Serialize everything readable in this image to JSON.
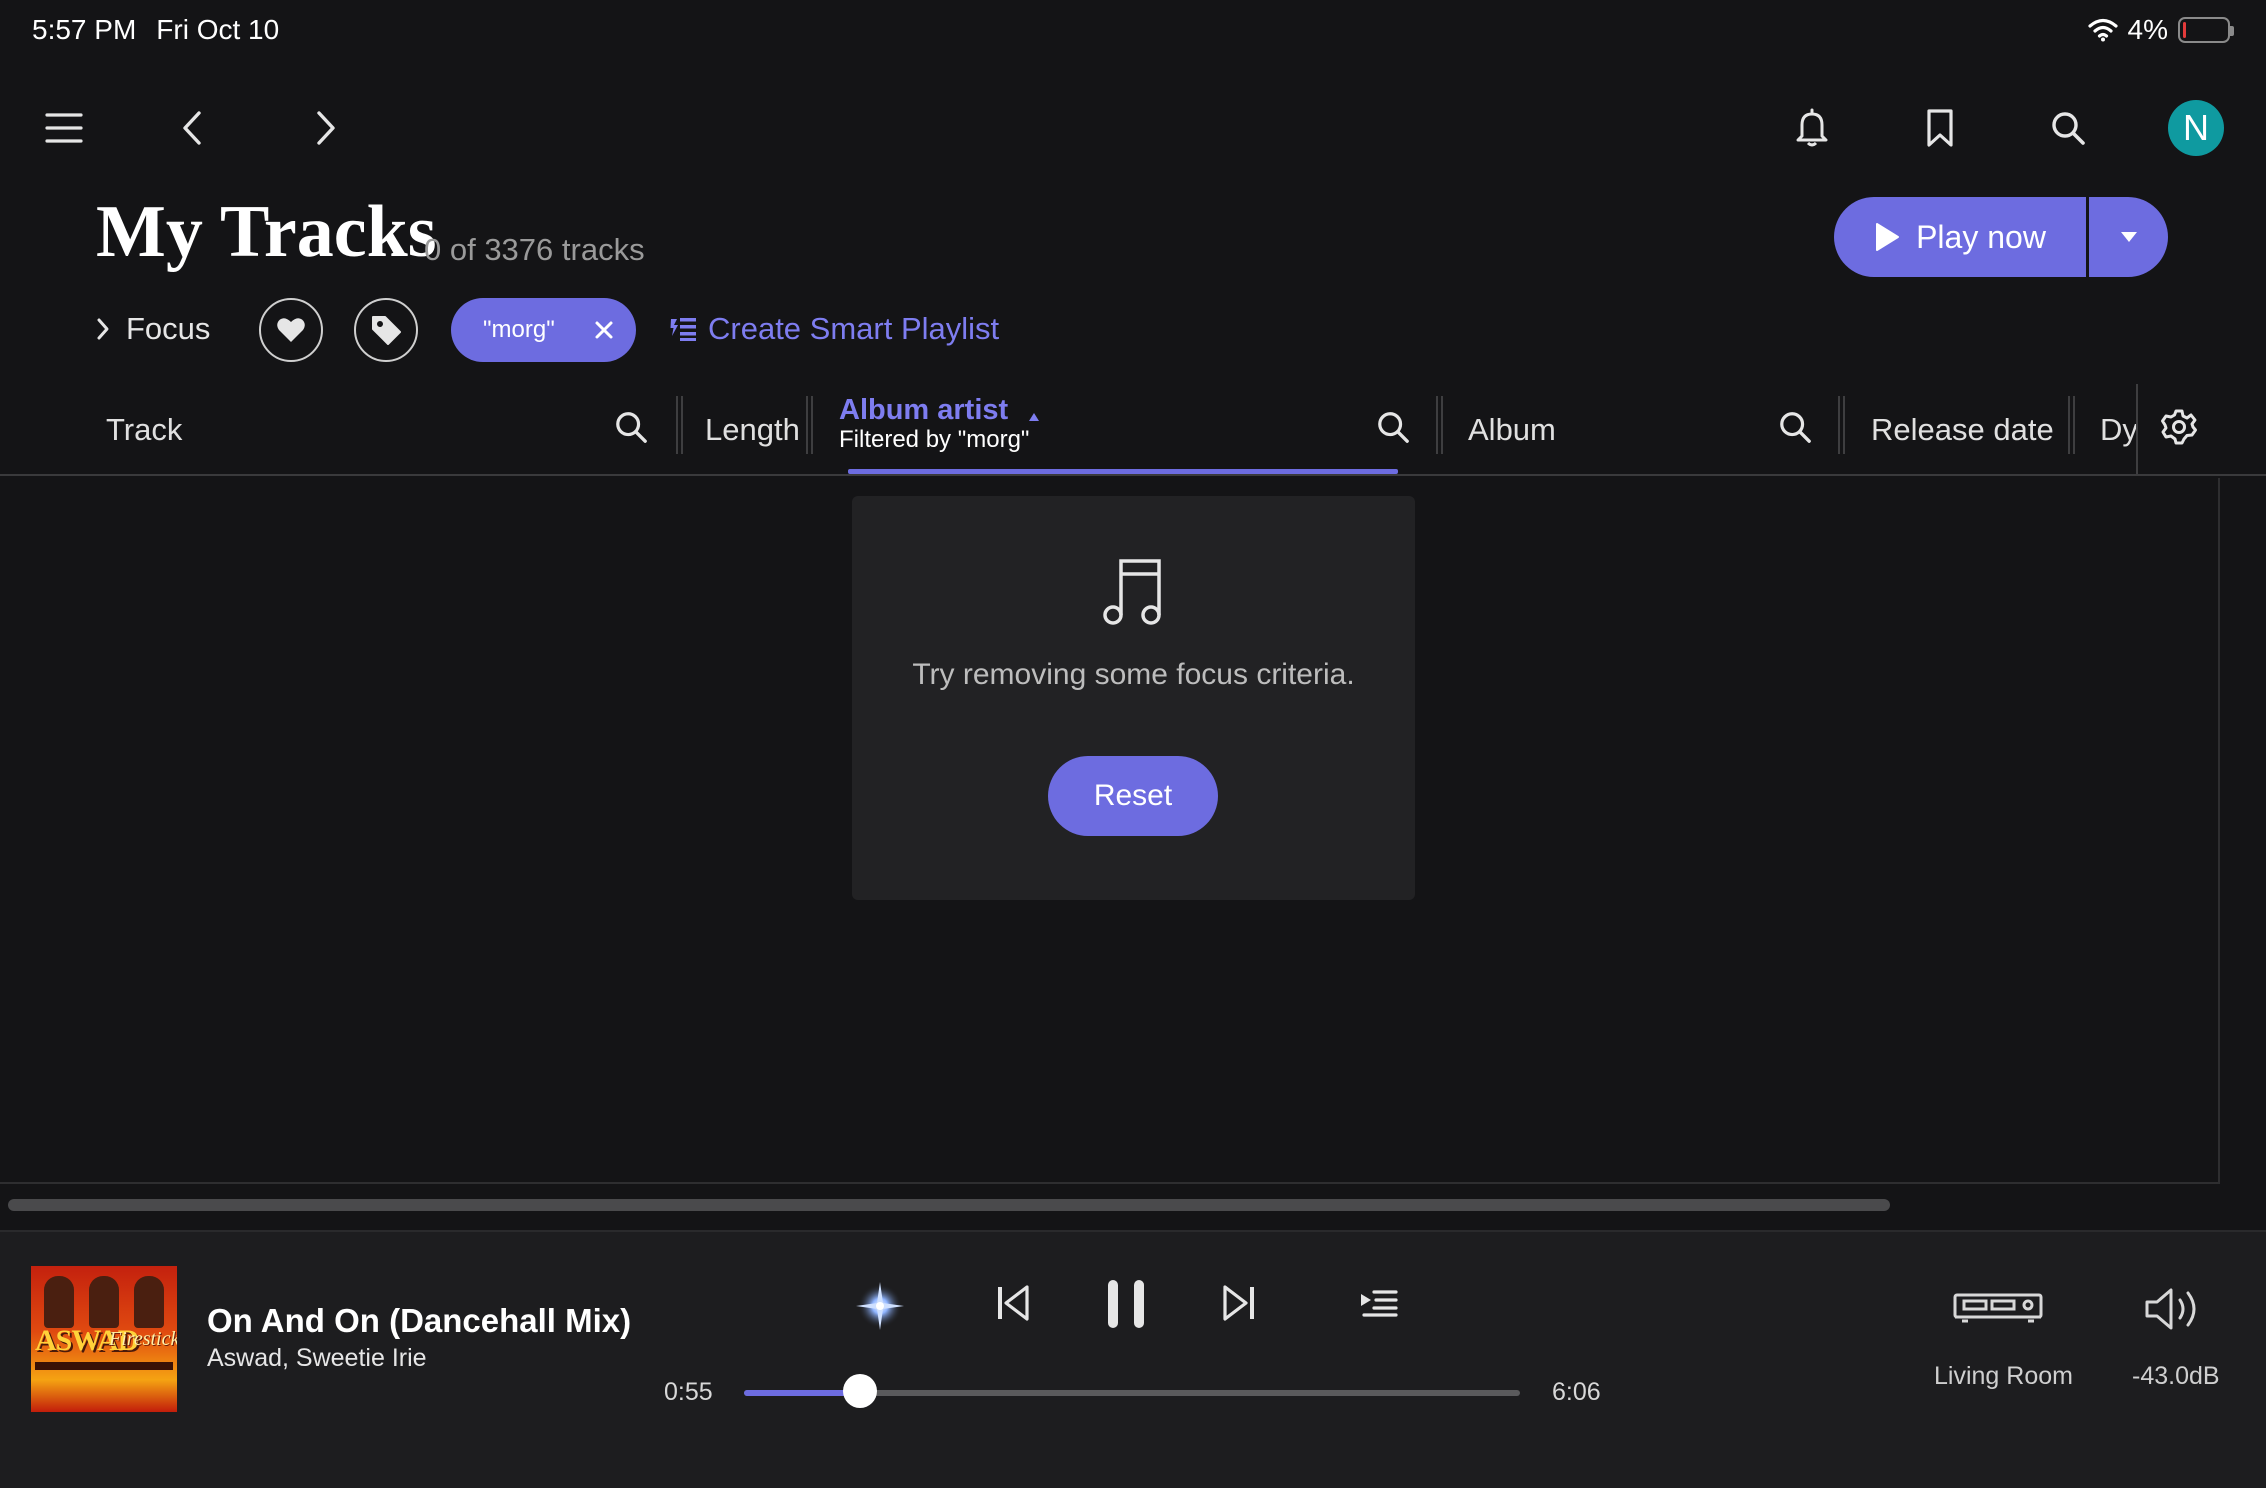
{
  "status_bar": {
    "time": "5:57 PM",
    "date": "Fri Oct 10",
    "battery_percent": "4%",
    "battery_level": 0.04
  },
  "nav": {
    "menu_icon": "hamburger-icon",
    "back_icon": "chevron-left-icon",
    "forward_icon": "chevron-right-icon",
    "notifications_icon": "bell-icon",
    "bookmarks_icon": "bookmark-icon",
    "search_icon": "search-icon",
    "avatar_initial": "N",
    "avatar_color": "#0f9aa0"
  },
  "header": {
    "title": "My Tracks",
    "track_count": "0 of 3376 tracks",
    "play_now_label": "Play now"
  },
  "filters": {
    "focus_label": "Focus",
    "active_chip": "\"morg\"",
    "create_smart_playlist": "Create Smart Playlist"
  },
  "columns": {
    "track": "Track",
    "length": "Length",
    "album_artist": "Album artist",
    "album_artist_filter": "Filtered by \"morg\"",
    "album": "Album",
    "release_date": "Release date",
    "dy": "Dy"
  },
  "empty_state": {
    "icon": "music-note-icon",
    "message": "Try removing some focus criteria.",
    "reset_label": "Reset"
  },
  "now_playing": {
    "title": "On And On (Dancehall Mix)",
    "artist": "Aswad, Sweetie Irie",
    "album_art_text": "ASWAD",
    "album_art_subtext": "Firesticks",
    "elapsed": "0:55",
    "duration": "6:06",
    "progress": 0.15,
    "zone": "Living Room",
    "volume": "-43.0dB"
  },
  "colors": {
    "accent": "#6d6ce0",
    "background": "#141416",
    "card": "#222224",
    "player_bg": "#1d1d1f"
  }
}
